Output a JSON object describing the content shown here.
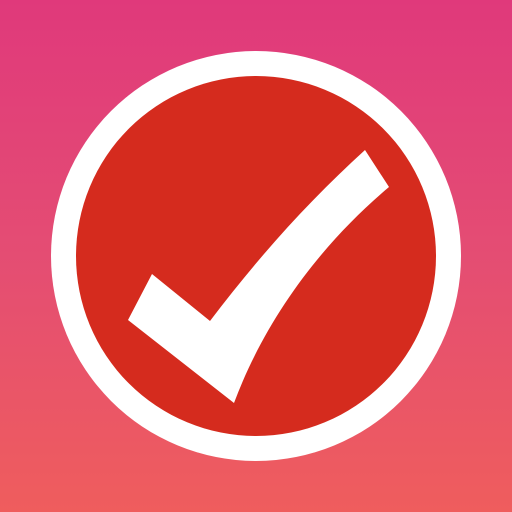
{
  "app_icon": {
    "icon": "checkmark-icon",
    "colors": {
      "background_top": "#e0397b",
      "background_mid": "#e44d73",
      "background_bottom": "#ef5d5d",
      "ring": "#ffffff",
      "disc": "#d52b1e",
      "check": "#ffffff"
    }
  }
}
